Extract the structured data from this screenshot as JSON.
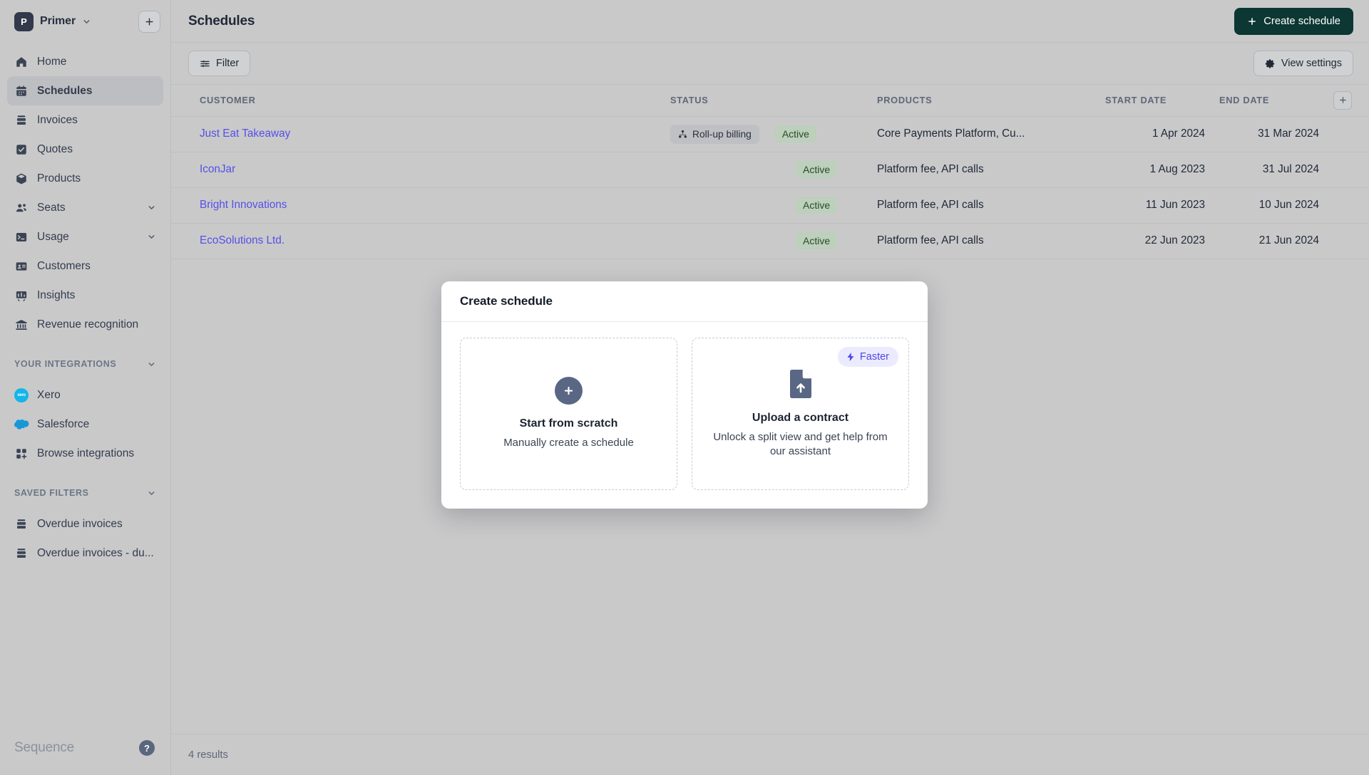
{
  "sidebar": {
    "workspace": {
      "initial": "P",
      "name": "Primer",
      "chevron_icon": "chevron-down-icon"
    },
    "add_button": {
      "icon": "plus-icon"
    },
    "nav": [
      {
        "label": "Home",
        "icon": "home-icon",
        "active": false,
        "expandable": false
      },
      {
        "label": "Schedules",
        "icon": "calendar-icon",
        "active": true,
        "expandable": false
      },
      {
        "label": "Invoices",
        "icon": "invoice-icon",
        "active": false,
        "expandable": false
      },
      {
        "label": "Quotes",
        "icon": "quote-check-icon",
        "active": false,
        "expandable": false
      },
      {
        "label": "Products",
        "icon": "box-icon",
        "active": false,
        "expandable": false
      },
      {
        "label": "Seats",
        "icon": "users-icon",
        "active": false,
        "expandable": true
      },
      {
        "label": "Usage",
        "icon": "terminal-icon",
        "active": false,
        "expandable": true
      },
      {
        "label": "Customers",
        "icon": "id-card-icon",
        "active": false,
        "expandable": false
      },
      {
        "label": "Insights",
        "icon": "insights-icon",
        "active": false,
        "expandable": false
      },
      {
        "label": "Revenue recognition",
        "icon": "bank-icon",
        "active": false,
        "expandable": false
      }
    ],
    "integrations_header": {
      "label": "YOUR INTEGRATIONS",
      "chevron_icon": "chevron-down-icon"
    },
    "integrations": [
      {
        "label": "Xero",
        "icon": "xero-logo-icon"
      },
      {
        "label": "Salesforce",
        "icon": "salesforce-logo-icon"
      },
      {
        "label": "Browse integrations",
        "icon": "grid-plus-icon"
      }
    ],
    "saved_filters_header": {
      "label": "SAVED FILTERS",
      "chevron_icon": "chevron-down-icon"
    },
    "saved_filters": [
      {
        "label": "Overdue invoices",
        "icon": "invoice-icon"
      },
      {
        "label": "Overdue invoices - du...",
        "icon": "invoice-icon"
      }
    ],
    "footer": {
      "brand": "Sequence",
      "help_icon": "question-mark-icon",
      "help_label": "?"
    }
  },
  "header": {
    "title": "Schedules",
    "create_button": {
      "label": "Create schedule",
      "icon": "plus-icon"
    }
  },
  "toolbar": {
    "filter_button": {
      "label": "Filter",
      "icon": "filter-sliders-icon"
    },
    "view_settings_button": {
      "label": "View settings",
      "icon": "gear-icon"
    }
  },
  "table": {
    "columns": [
      "CUSTOMER",
      "STATUS",
      "PRODUCTS",
      "START DATE",
      "END DATE"
    ],
    "add_column_icon": "plus-icon",
    "rows": [
      {
        "customer": "Just Eat Takeaway",
        "tag": "Roll-up billing",
        "tag_icon": "hierarchy-icon",
        "status": "Active",
        "products": "Core Payments Platform, Cu...",
        "start_date": "1 Apr 2024",
        "end_date": "31 Mar 2024"
      },
      {
        "customer": "IconJar",
        "tag": "",
        "tag_icon": "",
        "status": "Active",
        "products": "Platform fee, API calls",
        "start_date": "1 Aug 2023",
        "end_date": "31 Jul 2024"
      },
      {
        "customer": "Bright Innovations",
        "tag": "",
        "tag_icon": "",
        "status": "Active",
        "products": "Platform fee, API calls",
        "start_date": "11 Jun 2023",
        "end_date": "10 Jun 2024"
      },
      {
        "customer": "EcoSolutions Ltd.",
        "tag": "",
        "tag_icon": "",
        "status": "Active",
        "products": "Platform fee, API calls",
        "start_date": "22 Jun 2023",
        "end_date": "21 Jun 2024"
      }
    ]
  },
  "footer": {
    "results": "4 results"
  },
  "modal": {
    "title": "Create schedule",
    "options": [
      {
        "title": "Start from scratch",
        "subtitle": "Manually create a schedule",
        "icon": "circle-plus-icon",
        "badge": ""
      },
      {
        "title": "Upload a contract",
        "subtitle": "Unlock a split view and get help from our assistant",
        "icon": "file-upload-icon",
        "badge": "Faster",
        "badge_icon": "lightning-bolt-icon"
      }
    ]
  },
  "colors": {
    "primary_button": "#0c3733",
    "link": "#5550e6",
    "status_active_bg": "#bcd0bb",
    "status_active_text": "#2a4a2c",
    "badge_faster_bg": "#ebebfd",
    "badge_faster_text": "#4f46e5",
    "page_bg": "#c9c9ca",
    "sidebar_bg": "#c9c9ca"
  }
}
